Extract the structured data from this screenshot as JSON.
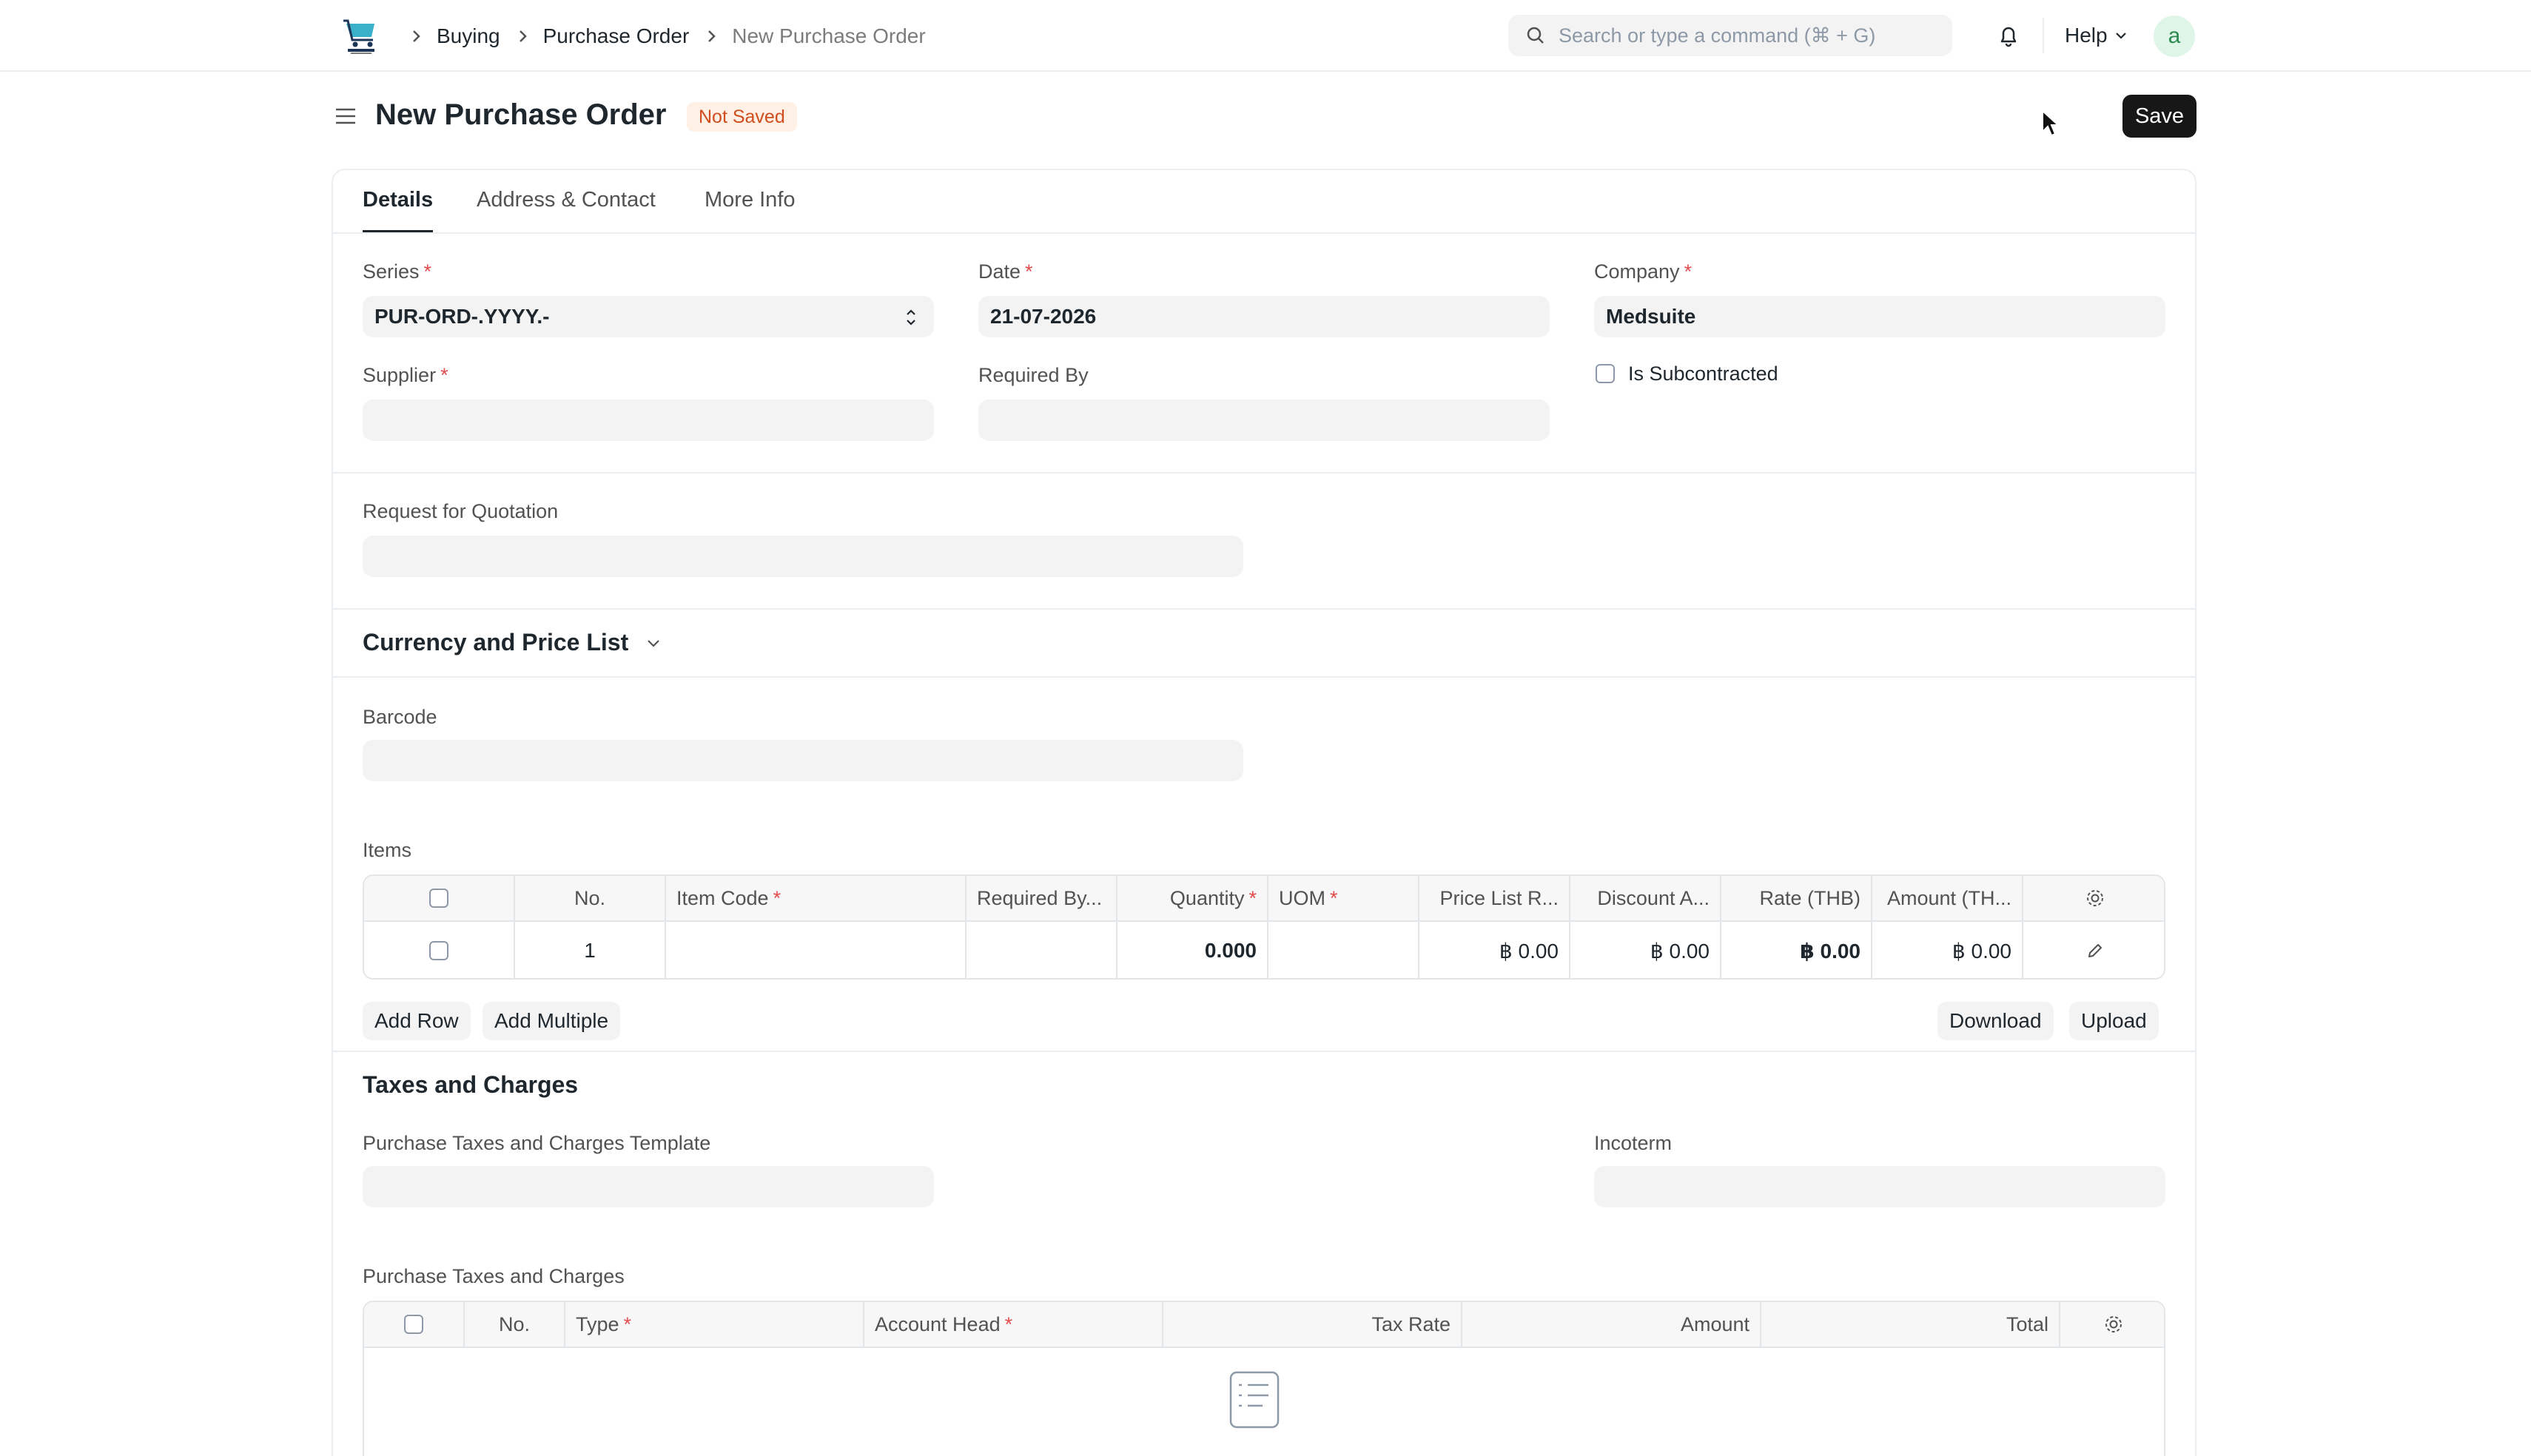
{
  "navbar": {
    "breadcrumbs": [
      "Buying",
      "Purchase Order",
      "New Purchase Order"
    ],
    "search_placeholder": "Search or type a command (⌘ + G)",
    "help_label": "Help",
    "avatar_initial": "a"
  },
  "page": {
    "title": "New Purchase Order",
    "status": "Not Saved",
    "save_label": "Save"
  },
  "tabs": [
    "Details",
    "Address & Contact",
    "More Info"
  ],
  "form": {
    "series": {
      "label": "Series",
      "value": "PUR-ORD-.YYYY.-"
    },
    "date": {
      "label": "Date",
      "value": "21-07-2026"
    },
    "company": {
      "label": "Company",
      "value": "Medsuite"
    },
    "supplier": {
      "label": "Supplier",
      "value": ""
    },
    "required_by": {
      "label": "Required By",
      "value": ""
    },
    "is_subcontracted": {
      "label": "Is Subcontracted",
      "checked": false
    },
    "request_for_quotation": {
      "label": "Request for Quotation",
      "value": ""
    },
    "currency_section": "Currency and Price List",
    "barcode": {
      "label": "Barcode",
      "value": ""
    },
    "items_label": "Items"
  },
  "items_table": {
    "headers": [
      "No.",
      "Item Code",
      "Required By...",
      "Quantity",
      "UOM",
      "Price List R...",
      "Discount A...",
      "Rate (THB)",
      "Amount (TH..."
    ],
    "rows": [
      {
        "no": "1",
        "item_code": "",
        "required_by": "",
        "quantity": "0.000",
        "uom": "",
        "price_list_rate": "฿ 0.00",
        "discount": "฿ 0.00",
        "rate": "฿ 0.00",
        "amount": "฿ 0.00"
      }
    ],
    "buttons": {
      "add_row": "Add Row",
      "add_multiple": "Add Multiple",
      "download": "Download",
      "upload": "Upload"
    }
  },
  "taxes": {
    "section_title": "Taxes and Charges",
    "template_label": "Purchase Taxes and Charges Template",
    "incoterm_label": "Incoterm",
    "table_label": "Purchase Taxes and Charges",
    "headers": [
      "No.",
      "Type",
      "Account Head",
      "Tax Rate",
      "Amount",
      "Total"
    ]
  },
  "colors": {
    "primary_button": "#171717",
    "status_badge_bg": "#fff0e6",
    "status_badge_text": "#d14d1d",
    "required_mark": "#e24c4c",
    "field_bg": "#f3f3f3"
  }
}
